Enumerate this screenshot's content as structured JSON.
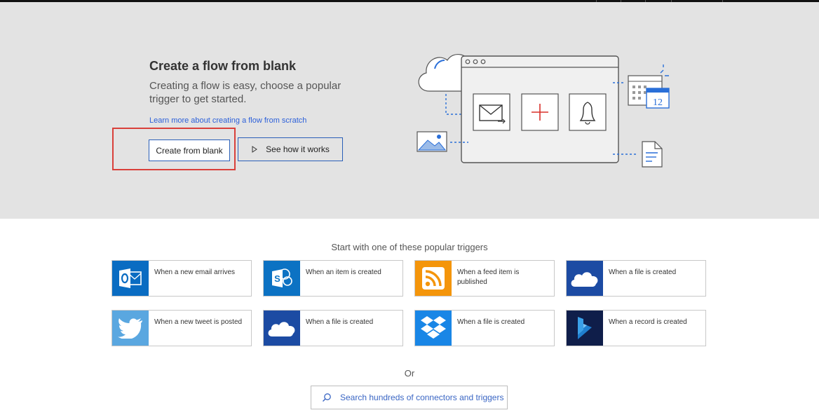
{
  "hero": {
    "title": "Create a flow from blank",
    "subtitle": "Creating a flow is easy, choose a popular trigger to get started.",
    "learn_more_link": "Learn more about creating a flow from scratch",
    "create_button": "Create from blank",
    "see_button": "See how it works",
    "illustration_calendar_day": "12"
  },
  "triggers": {
    "heading": "Start with one of these popular triggers",
    "items": [
      {
        "label": "When a new email arrives",
        "service_icon": "outlook-icon",
        "color": "#0a6cc2"
      },
      {
        "label": "When an item is created",
        "service_icon": "sharepoint-icon",
        "color": "#0c72c3"
      },
      {
        "label": "When a feed item is published",
        "service_icon": "rss-icon",
        "color": "#f4950b"
      },
      {
        "label": "When a file is created",
        "service_icon": "onedrive-icon",
        "color": "#1c4ba3"
      },
      {
        "label": "When a new tweet is posted",
        "service_icon": "twitter-icon",
        "color": "#5aa7e0"
      },
      {
        "label": "When a file is created",
        "service_icon": "onedrive-icon",
        "color": "#1c4ba3"
      },
      {
        "label": "When a file is created",
        "service_icon": "dropbox-icon",
        "color": "#1986e6"
      },
      {
        "label": "When a record is created",
        "service_icon": "dynamics-icon",
        "color": "#0f1e4a"
      }
    ]
  },
  "or_text": "Or",
  "search": {
    "placeholder": "Search hundreds of connectors and triggers"
  },
  "colors": {
    "accent": "#2a5fb8",
    "hero_background": "#e3e3e3",
    "highlight": "#d9403a"
  }
}
